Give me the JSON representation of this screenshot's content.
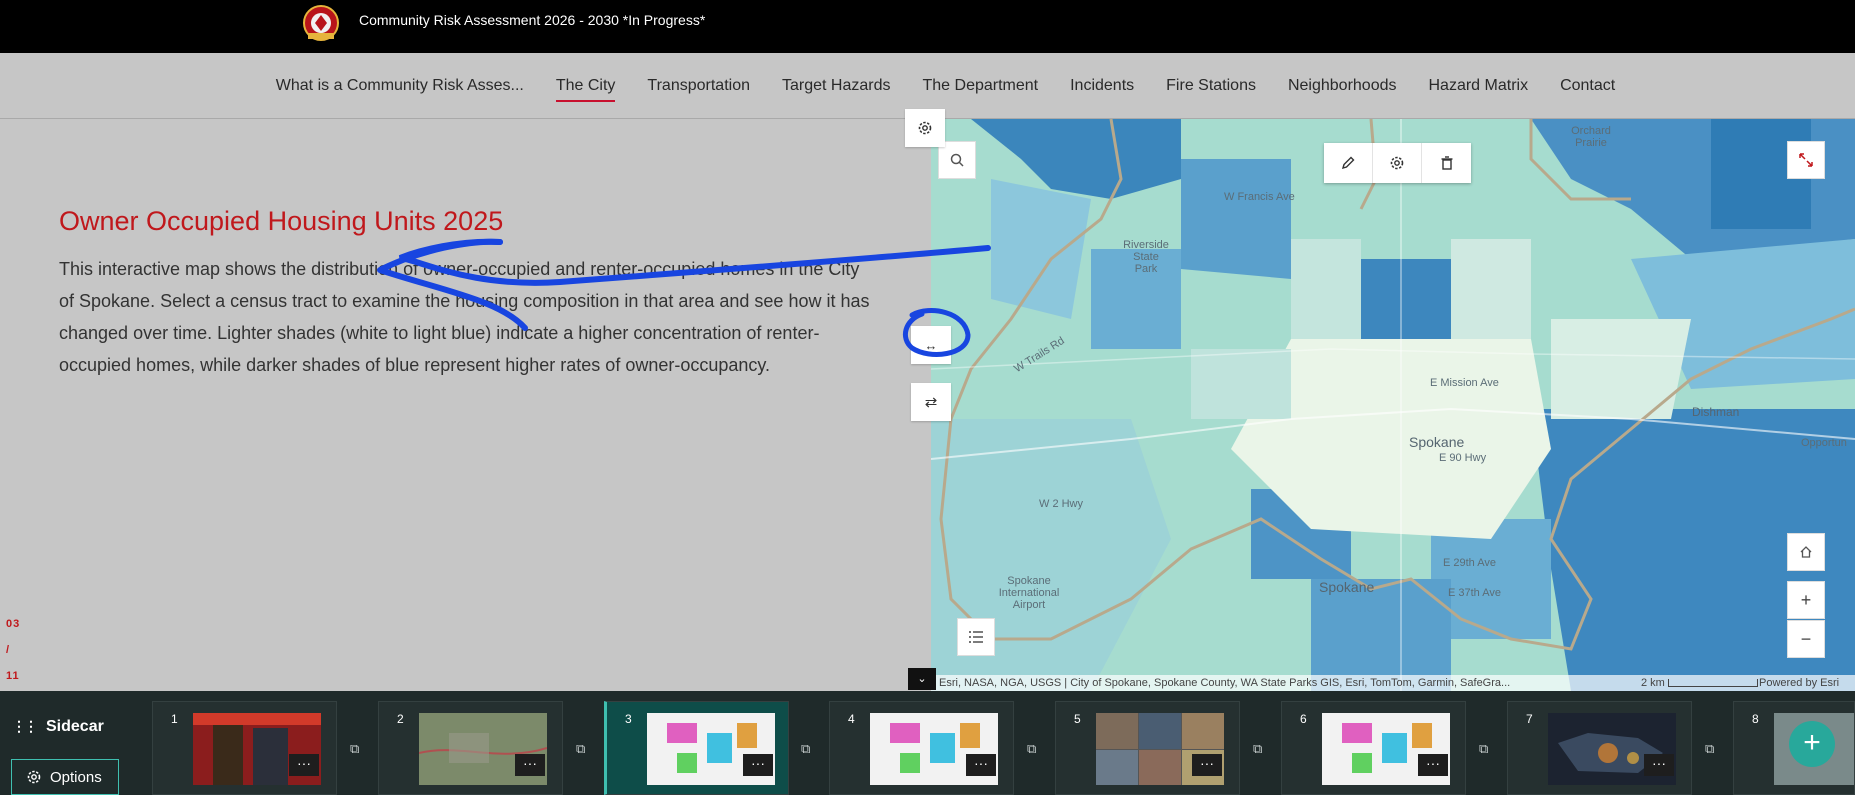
{
  "header": {
    "app_title": "Community Risk Assessment 2026 - 2030 *In Progress*"
  },
  "nav": {
    "items": [
      {
        "label": "What is a Community Risk Asses...",
        "active": false
      },
      {
        "label": "The City",
        "active": true
      },
      {
        "label": "Transportation",
        "active": false
      },
      {
        "label": "Target Hazards",
        "active": false
      },
      {
        "label": "The Department",
        "active": false
      },
      {
        "label": "Incidents",
        "active": false
      },
      {
        "label": "Fire Stations",
        "active": false
      },
      {
        "label": "Neighborhoods",
        "active": false
      },
      {
        "label": "Hazard Matrix",
        "active": false
      },
      {
        "label": "Contact",
        "active": false
      }
    ]
  },
  "story": {
    "title": "Owner Occupied Housing Units 2025",
    "body": "This interactive map shows the distribution of owner-occupied and renter-occupied homes in the City of Spokane. Select a census tract to examine the housing composition in that area and see how it has changed over time. Lighter shades (white to light blue) indicate a higher concentration of renter-occupied homes, while darker shades of blue represent higher rates of owner-occupancy.",
    "page_current": "03",
    "page_sep": "/",
    "page_total": "11"
  },
  "map": {
    "labels": {
      "orchard_prairie": "Orchard Prairie",
      "francis": "W Francis Ave",
      "mission": "E Mission Ave",
      "spokane": "Spokane",
      "spokane2": "Spokane",
      "e90": "E 90 Hwy",
      "w2": "W 2 Hwy",
      "trails": "W Trails Rd",
      "dishman": "Dishman",
      "airport": "Spokane International Airport",
      "e29": "E 29th Ave",
      "e37": "E 37th Ave",
      "riverside": "Riverside State Park",
      "opportunity": "Opportun"
    },
    "attribution": "Esri, NASA, NGA, USGS | City of Spokane, Spokane County, WA State Parks GIS, Esri, TomTom, Garmin, SafeGra...",
    "scale": "2 km",
    "powered": "Powered by Esri"
  },
  "sidecar": {
    "title": "Sidecar",
    "options_label": "Options",
    "slides": [
      {
        "num": "1",
        "more": "···"
      },
      {
        "num": "2",
        "more": "···"
      },
      {
        "num": "3",
        "more": "···"
      },
      {
        "num": "4",
        "more": "···"
      },
      {
        "num": "5",
        "more": "···"
      },
      {
        "num": "6",
        "more": "···"
      },
      {
        "num": "7",
        "more": "···"
      },
      {
        "num": "8",
        "more": "···"
      }
    ],
    "add_label": "+"
  },
  "colors": {
    "accent": "#c0181c",
    "teal": "#3fbfb0",
    "annotation": "#1845e0"
  }
}
